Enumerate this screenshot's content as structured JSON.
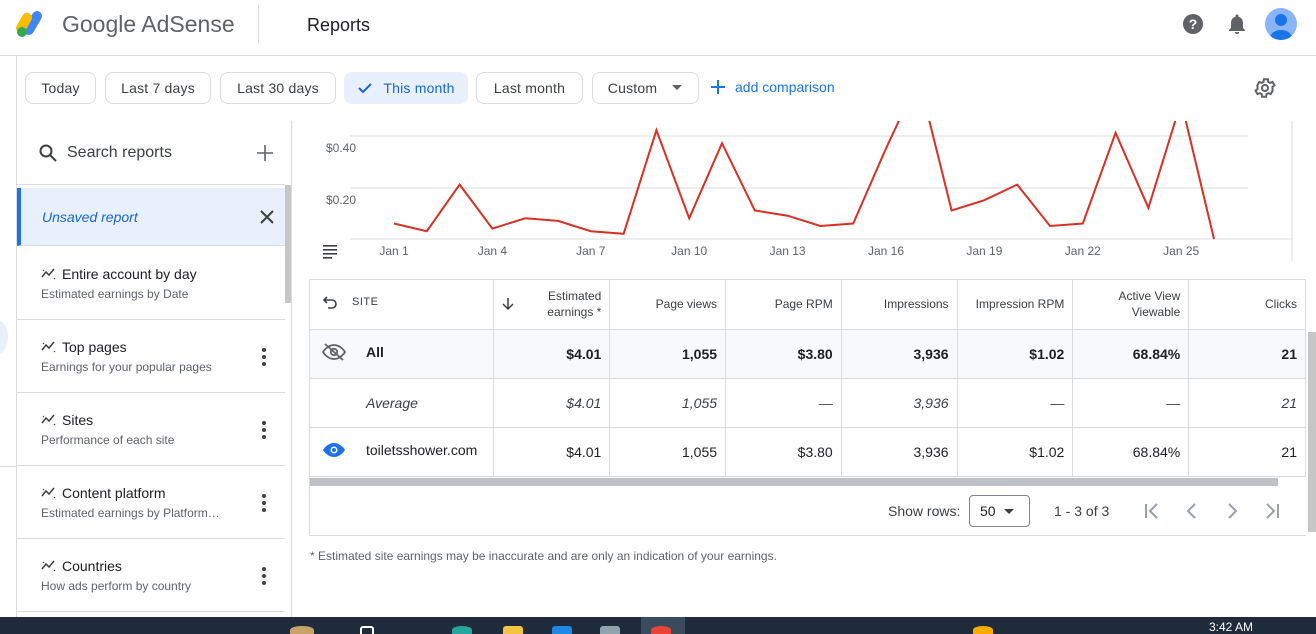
{
  "header": {
    "brand": "Google AdSense",
    "page_title": "Reports"
  },
  "datebar": {
    "chips": [
      "Today",
      "Last 7 days",
      "Last 30 days",
      "This month",
      "Last month",
      "Custom"
    ],
    "active_chip": "This month",
    "add_comparison": "add comparison"
  },
  "sidebar": {
    "search_label": "Search reports",
    "unsaved_label": "Unsaved report",
    "items": [
      {
        "title": "Entire account by day",
        "sub": "Estimated earnings by Date"
      },
      {
        "title": "Top pages",
        "sub": "Earnings for your popular pages"
      },
      {
        "title": "Sites",
        "sub": "Performance of each site"
      },
      {
        "title": "Content platform",
        "sub": "Estimated earnings by Platform…"
      },
      {
        "title": "Countries",
        "sub": "How ads perform by country"
      }
    ]
  },
  "chart_data": {
    "type": "line",
    "y_tick_labels": [
      "$0.40",
      "$0.20"
    ],
    "x_tick_labels": [
      "Jan 1",
      "Jan 4",
      "Jan 7",
      "Jan 10",
      "Jan 13",
      "Jan 16",
      "Jan 19",
      "Jan 22",
      "Jan 25"
    ],
    "series_color": "#d93025",
    "series": [
      {
        "x": [
          "Jan 1",
          "Jan 2",
          "Jan 3",
          "Jan 4",
          "Jan 5",
          "Jan 6",
          "Jan 7",
          "Jan 8",
          "Jan 9",
          "Jan 10",
          "Jan 11",
          "Jan 12",
          "Jan 13",
          "Jan 14",
          "Jan 15",
          "Jan 16",
          "Jan 17",
          "Jan 18",
          "Jan 19",
          "Jan 20",
          "Jan 21",
          "Jan 22",
          "Jan 23",
          "Jan 24",
          "Jan 25",
          "Jan 26"
        ],
        "values": [
          0.06,
          0.03,
          0.21,
          0.04,
          0.08,
          0.07,
          0.03,
          0.02,
          0.42,
          0.08,
          0.37,
          0.11,
          0.09,
          0.05,
          0.06,
          0.35,
          0.62,
          0.11,
          0.15,
          0.21,
          0.05,
          0.06,
          0.41,
          0.12,
          0.53,
          0.0
        ]
      }
    ]
  },
  "table": {
    "headers": [
      "SITE",
      "Estimated earnings *",
      "Page views",
      "Page RPM",
      "Impressions",
      "Impression RPM",
      "Active View Viewable",
      "Clicks"
    ],
    "rows": [
      {
        "label": "All",
        "values": [
          "$4.01",
          "1,055",
          "$3.80",
          "3,936",
          "$1.02",
          "68.84%",
          "21"
        ]
      },
      {
        "label": "Average",
        "values": [
          "$4.01",
          "1,055",
          "—",
          "3,936",
          "—",
          "—",
          "21"
        ]
      },
      {
        "label": "toiletsshower.com",
        "values": [
          "$4.01",
          "1,055",
          "$3.80",
          "3,936",
          "$1.02",
          "68.84%",
          "21"
        ]
      }
    ],
    "show_rows_label": "Show rows:",
    "rows_per_page": "50",
    "range": "1 - 3 of 3"
  },
  "footnote": "* Estimated site earnings may be inaccurate and are only an indication of your earnings.",
  "taskbar": {
    "clock": "3:42 AM"
  }
}
